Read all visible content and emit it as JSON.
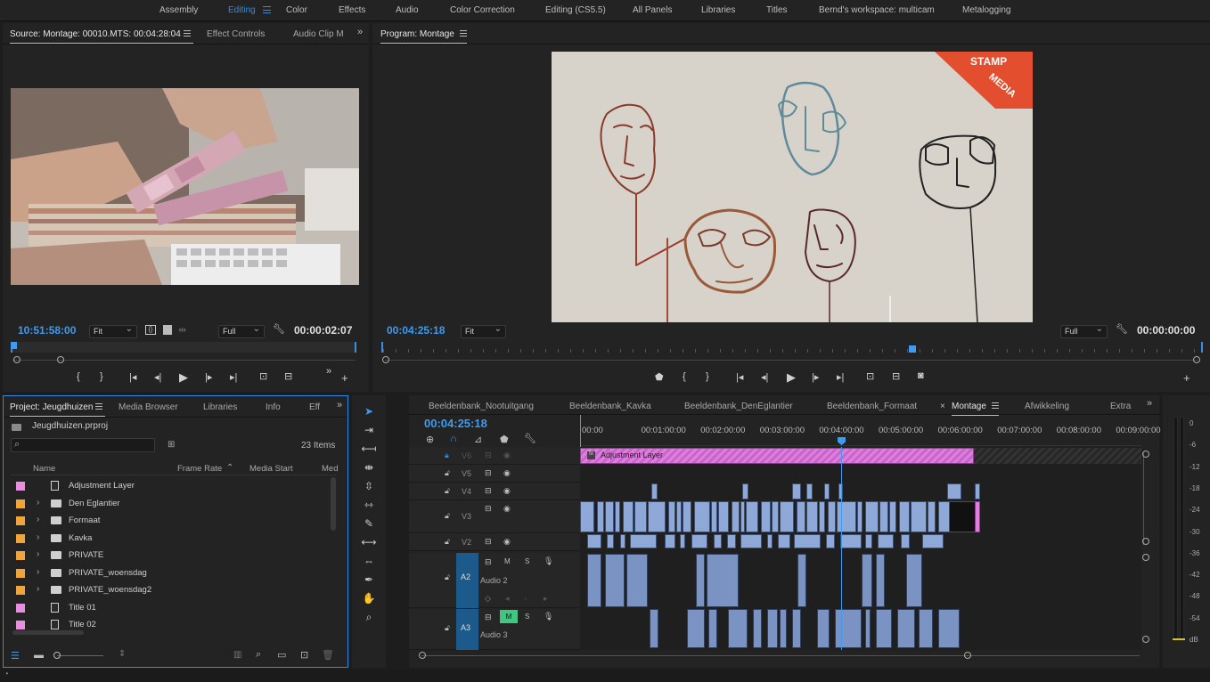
{
  "workspaces": {
    "tabs": [
      "Assembly",
      "Editing",
      "Color",
      "Effects",
      "Audio",
      "Color Correction",
      "Editing (CS5.5)",
      "All Panels",
      "Libraries",
      "Titles",
      "Bernd's workspace: multicam",
      "Metalogging"
    ],
    "active": "Editing"
  },
  "source": {
    "tab_title": "Source: Montage: 00010.MTS: 00:04:28:04",
    "tab_effect_controls": "Effect Controls",
    "tab_audio_clip": "Audio Clip M",
    "timecode_in": "10:51:58:00",
    "zoom": "Fit",
    "quality": "Full",
    "duration": "00:00:02:07"
  },
  "program": {
    "tab_title": "Program: Montage",
    "timecode": "00:04:25:18",
    "zoom": "Fit",
    "quality": "Full",
    "end_timecode": "00:00:00:00",
    "watermark_top": "STAMP",
    "watermark_bottom": "MEDIA"
  },
  "project": {
    "tab_title": "Project: Jeugdhuizen",
    "tab_media_browser": "Media Browser",
    "tab_libraries": "Libraries",
    "tab_info": "Info",
    "tab_effects": "Eff",
    "file_name": "Jeugdhuizen.prproj",
    "items_count": "23 Items",
    "columns": [
      "Name",
      "Frame Rate",
      "Media Start",
      "Med"
    ],
    "items": [
      {
        "name": "Adjustment Layer",
        "type": "file",
        "color": "#e88de0"
      },
      {
        "name": "Den Eglantier",
        "type": "folder",
        "color": "#f0a43c"
      },
      {
        "name": "Formaat",
        "type": "folder",
        "color": "#f0a43c"
      },
      {
        "name": "Kavka",
        "type": "folder",
        "color": "#f0a43c"
      },
      {
        "name": "PRIVATE",
        "type": "folder",
        "color": "#f0a43c"
      },
      {
        "name": "PRIVATE_woensdag",
        "type": "folder",
        "color": "#f0a43c"
      },
      {
        "name": "PRIVATE_woensdag2",
        "type": "folder",
        "color": "#f0a43c"
      },
      {
        "name": "Title 01",
        "type": "file",
        "color": "#e88de0"
      },
      {
        "name": "Title 02",
        "type": "file",
        "color": "#e88de0"
      }
    ]
  },
  "timeline": {
    "sequence_tabs": [
      "Beeldenbank_Nootuitgang",
      "Beeldenbank_Kavka",
      "Beeldenbank_DenEglantier",
      "Beeldenbank_Formaat",
      "Montage",
      "Afwikkeling",
      "Extra"
    ],
    "active_sequence": "Montage",
    "timecode": "00:04:25:18",
    "ruler": [
      "00:00",
      "00:01:00:00",
      "00:02:00:00",
      "00:03:00:00",
      "00:04:00:00",
      "00:05:00:00",
      "00:06:00:00",
      "00:07:00:00",
      "00:08:00:00",
      "00:09:00:00"
    ],
    "adjustment_clip": "Adjustment Layer",
    "video_tracks": [
      "V6",
      "V5",
      "V4",
      "V3",
      "V2"
    ],
    "audio_tracks": [
      {
        "id": "A2",
        "name": "Audio 2"
      },
      {
        "id": "A3",
        "name": "Audio 3"
      }
    ],
    "track_buttons": {
      "mute": "M",
      "solo": "S"
    }
  },
  "meter": {
    "scale": [
      "0",
      "-6",
      "-12",
      "-18",
      "-24",
      "-30",
      "-36",
      "-42",
      "-48",
      "-54"
    ],
    "unit": "dB"
  },
  "colors": {
    "accent": "#2d8ceb",
    "adjustment_clip": "#e07ee0",
    "video_clip": "#8ea9d8",
    "audio_clip": "#7b93c2",
    "track_target": "#1d5a8c"
  }
}
